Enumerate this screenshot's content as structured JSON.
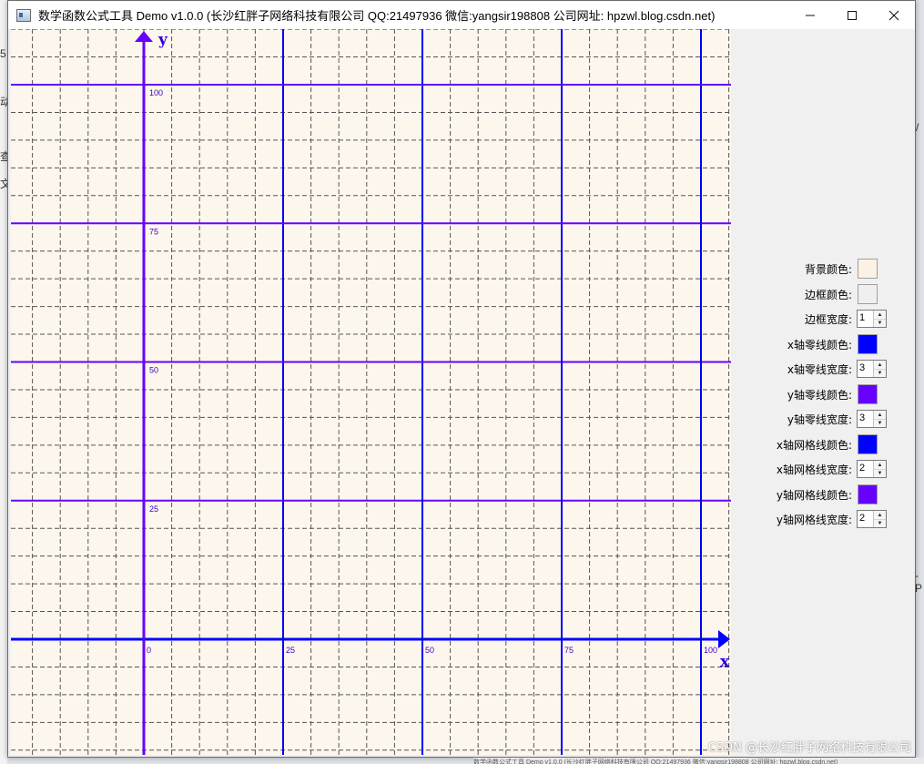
{
  "window": {
    "title": "数学函数公式工具 Demo v1.0.0 (长沙红胖子网络科技有限公司 QQ:21497936 微信:yangsir198808 公司网址: hpzwl.blog.csdn.net)",
    "buttons": {
      "minimize": "minimize-icon",
      "maximize": "maximize-icon",
      "close": "close-icon"
    }
  },
  "plot": {
    "background_color": "#fdf6ec",
    "x_axis_label": "x",
    "y_axis_label": "y",
    "x_ticks": [
      "0",
      "25",
      "50",
      "75",
      "100"
    ],
    "y_ticks": [
      "25",
      "50",
      "75",
      "100"
    ],
    "x_zero_line_color": "#0000ff",
    "x_zero_line_width": 3,
    "y_zero_line_color": "#6600ff",
    "y_zero_line_width": 3,
    "x_grid_color": "#0000ff",
    "x_grid_width": 2,
    "y_grid_color": "#6600ff",
    "y_grid_width": 2,
    "minor_grid": "dashed"
  },
  "panel": {
    "rows": [
      {
        "label": "背景颜色:",
        "kind": "color",
        "value": "#fcf1e5"
      },
      {
        "label": "边框颜色:",
        "kind": "color",
        "value": "#efefef"
      },
      {
        "label": "边框宽度:",
        "kind": "spin",
        "value": "1"
      },
      {
        "label": "x轴零线颜色:",
        "kind": "color",
        "value": "#0000ff"
      },
      {
        "label": "x轴零线宽度:",
        "kind": "spin",
        "value": "3"
      },
      {
        "label": "y轴零线颜色:",
        "kind": "color",
        "value": "#6600ff"
      },
      {
        "label": "y轴零线宽度:",
        "kind": "spin",
        "value": "3"
      },
      {
        "label": "x轴网格线颜色:",
        "kind": "color",
        "value": "#0000ff"
      },
      {
        "label": "x轴网格线宽度:",
        "kind": "spin",
        "value": "2"
      },
      {
        "label": "y轴网格线颜色:",
        "kind": "color",
        "value": "#6600ff"
      },
      {
        "label": "y轴网格线宽度:",
        "kind": "spin",
        "value": "2"
      }
    ]
  },
  "background": {
    "fragments": [
      "5",
      "动",
      "查",
      "文",
      "-P",
      "/"
    ],
    "taskbar_text": "数学函数公式工具 Demo v1.0.0 (长沙红胖子网络科技有限公司 QQ:21497936 微信:yangsir198808 公司网址: hpzwl.blog.csdn.net)"
  },
  "watermark": "CSDN @长沙红胖子网络科技有限公司"
}
